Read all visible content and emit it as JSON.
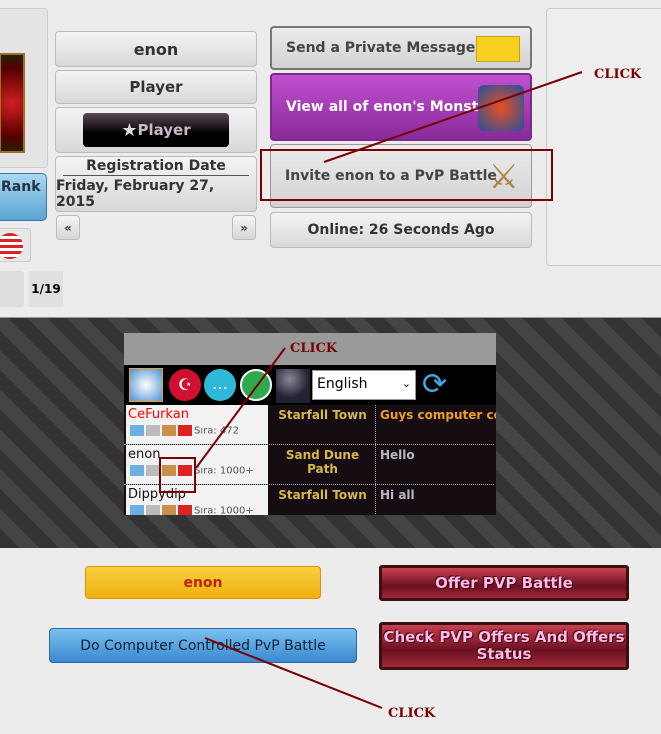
{
  "profile": {
    "username": "enon",
    "role": "Player",
    "badge": "Player",
    "reg_label": "Registration Date",
    "reg_date": "Friday, February 27, 2015",
    "rank_label": "Rank",
    "page_counter": "1/19"
  },
  "actions": {
    "send_message": "Send a Private Message",
    "view_monsters": "View all of enon's Monsters",
    "invite_pvp": "Invite enon to a PvP Battle",
    "online": "Online: 26 Seconds Ago"
  },
  "annotations": {
    "click": "CLICK"
  },
  "chat": {
    "language": "English",
    "rows": [
      {
        "name": "CeFurkan",
        "name_color": "#ff0000",
        "sira": "Sıra: 472",
        "location": "Starfall Town",
        "message": "Guys computer co",
        "msg_color": "#f0a020"
      },
      {
        "name": "enon",
        "name_color": "#111111",
        "sira": "Sıra: 1000+",
        "location": "Sand Dune Path",
        "message": "Hello",
        "msg_color": "#b8b8c8"
      },
      {
        "name": "Dippydip",
        "name_color": "#111111",
        "sira": "Sıra: 1000+",
        "location": "Starfall Town",
        "message": "Hi all",
        "msg_color": "#b8b8c8"
      }
    ]
  },
  "battle": {
    "opponent": "enon",
    "computer_battle": "Do Computer Controlled PvP Battle",
    "offer_pvp": "Offer PVP Battle",
    "check_offers": "Check PVP Offers And Offers Status"
  }
}
